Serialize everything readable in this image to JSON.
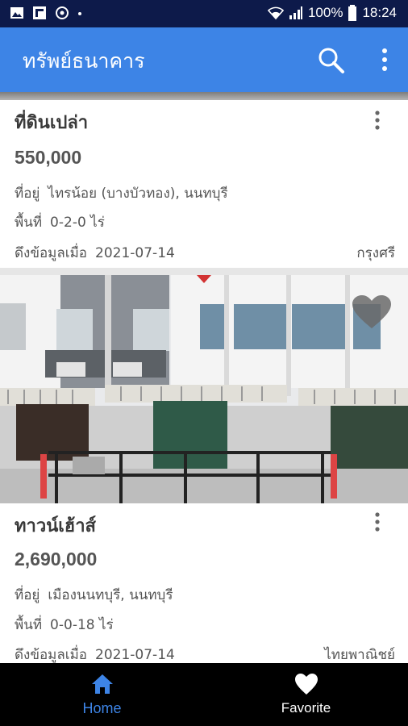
{
  "status_bar": {
    "battery": "100%",
    "time": "18:24",
    "left_icons": [
      "image-icon",
      "flipboard-icon",
      "sync-icon",
      "dot-icon"
    ],
    "right_icons": [
      "wifi-icon",
      "signal-icon",
      "battery-icon"
    ]
  },
  "app_bar": {
    "title": "ทรัพย์ธนาคาร",
    "color": "#3d84e6"
  },
  "listings": [
    {
      "title": "ที่ดินเปล่า",
      "price": "550,000",
      "location_label": "ที่อยู่",
      "location": "ไทรน้อย (บางบัวทอง), นนทบุรี",
      "area_label": "พื้นที่",
      "area": "0-2-0 ไร่",
      "fetched_label": "ดึงข้อมูลเมื่อ",
      "fetched_date": "2021-07-14",
      "bank": "กรุงศรี"
    },
    {
      "title": "ทาวน์เฮ้าส์",
      "price": "2,690,000",
      "location_label": "ที่อยู่",
      "location": "เมืองนนทบุรี, นนทบุรี",
      "area_label": "พื้นที่",
      "area": "0-0-18 ไร่",
      "fetched_label": "ดึงข้อมูลเมื่อ",
      "fetched_date": "2021-07-14",
      "bank": "ไทยพาณิชย์"
    }
  ],
  "bottom_nav": {
    "home_label": "Home",
    "favorite_label": "Favorite",
    "active": "home",
    "active_color": "#3d84e6"
  }
}
